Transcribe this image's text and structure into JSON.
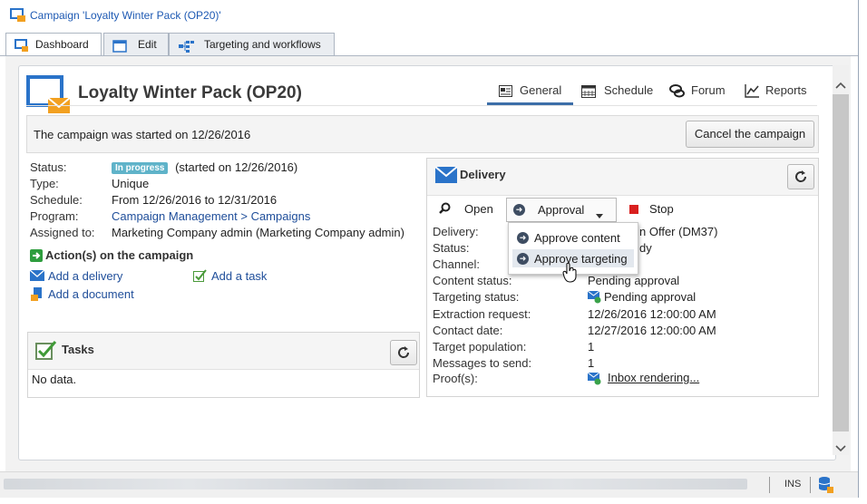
{
  "window": {
    "title": "Campaign 'Loyalty Winter Pack (OP20)'"
  },
  "tabs": [
    {
      "label": "Dashboard"
    },
    {
      "label": "Edit"
    },
    {
      "label": "Targeting and workflows"
    }
  ],
  "header": {
    "title": "Loyalty Winter Pack (OP20)",
    "nav": [
      {
        "label": "General"
      },
      {
        "label": "Schedule"
      },
      {
        "label": "Forum"
      },
      {
        "label": "Reports"
      }
    ]
  },
  "infobar": {
    "message": "The campaign was started on 12/26/2016",
    "cancel_label": "Cancel the campaign"
  },
  "summary": {
    "labels": [
      "Status:",
      "Type:",
      "Schedule:",
      "Program:",
      "Assigned to:"
    ],
    "status_badge": "In progress",
    "status_note": "(started on 12/26/2016)",
    "type": "Unique",
    "schedule": "From 12/26/2016 to 12/31/2016",
    "program": "Campaign Management > Campaigns",
    "assigned_to": "Marketing Company admin (Marketing Company admin)"
  },
  "actions": {
    "title": "Action(s) on the campaign",
    "add_delivery": "Add a delivery",
    "add_task": "Add a task",
    "add_document": "Add a document"
  },
  "tasks": {
    "title": "Tasks",
    "empty": "No data."
  },
  "delivery": {
    "title": "Delivery",
    "open_label": "Open",
    "approval_label": "Approval",
    "stop_label": "Stop",
    "menu": [
      {
        "label": "Approve content"
      },
      {
        "label": "Approve targeting"
      }
    ],
    "labels": [
      "Delivery:",
      "Status:",
      "Channel:",
      "Content status:",
      "Targeting status:",
      "Extraction request:",
      "Contact date:",
      "Target population:",
      "Messages to send:",
      "Proof(s):"
    ],
    "delivery_value_partial": "n Offer (DM37)",
    "status_value_partial": "dy",
    "content_status": "Pending approval",
    "targeting_status": "Pending approval",
    "extraction_request": "12/26/2016 12:00:00 AM",
    "contact_date": "12/27/2016 12:00:00 AM",
    "target_population": "1",
    "messages_to_send": "1",
    "proofs": "Inbox rendering..."
  },
  "statusbar": {
    "mode": "INS"
  },
  "colors": {
    "accent": "#1f4e9a",
    "badge": "#5fb3c9",
    "envelope": "#2a73c9",
    "envelope_flap": "#f2a020",
    "stop": "#d9201f"
  }
}
